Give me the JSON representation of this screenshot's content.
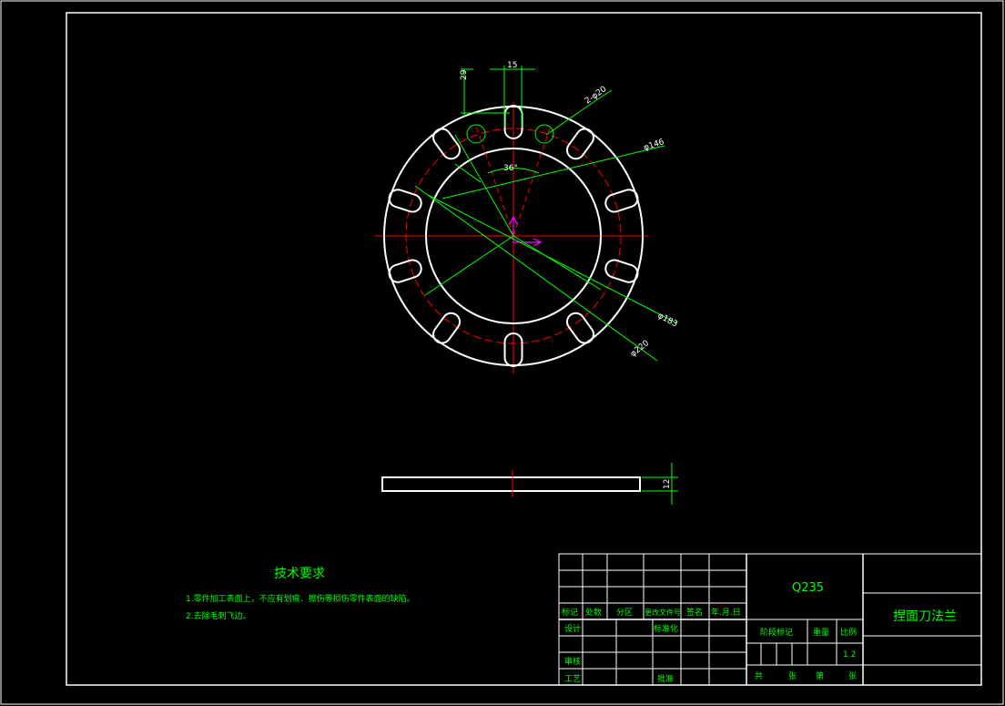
{
  "drawing": {
    "part_name": "捏面刀法兰",
    "material": "Q235",
    "scale": "1 2"
  },
  "dimensions": {
    "slot_width": "15",
    "slot_offset": "29",
    "hole_callout": "2-φ20",
    "angle": "36°",
    "d_inner": "φ146",
    "d_pitch": "φ183",
    "d_outer": "φ220",
    "thickness": "12"
  },
  "notes": {
    "title": "技术要求",
    "items": [
      "1.零件加工表面上，不应有划痕、擦伤等损伤零件表面的缺陷。",
      "2.去除毛刺飞边。"
    ]
  },
  "title_block": {
    "rev_headers": [
      "标记",
      "处数",
      "分区",
      "更改文件号",
      "签名",
      "年.月.日"
    ],
    "design": "设计",
    "standardize": "标准化",
    "check": "审核",
    "process": "工艺",
    "approve": "批准",
    "stage_mark": "阶段标记",
    "weight": "重量",
    "scale_label": "比例",
    "sheet_total": "共",
    "sheet_unit": "张",
    "sheet_no": "第",
    "sheet_unit2": "张"
  },
  "colors": {
    "outline": "#ffffff",
    "center_line": "#ff0000",
    "dimension": "#00ff00",
    "axis": "#ff00ff"
  }
}
